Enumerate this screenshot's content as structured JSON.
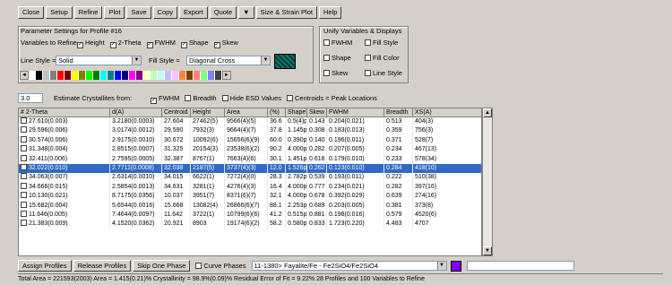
{
  "toolbar": [
    "Close",
    "Setup",
    "Refine",
    "Plot",
    "Save",
    "Copy",
    "Export",
    "Quote",
    "▼",
    "Size & Strain Plot",
    "Help"
  ],
  "params": {
    "group_title": "Parameter Settings for Profile #16",
    "vary_label": "Variables to Refine",
    "vary": [
      {
        "label": "Height",
        "checked": true
      },
      {
        "label": "2-Theta",
        "checked": true
      },
      {
        "label": "FWHM",
        "checked": true
      },
      {
        "label": "Shape",
        "checked": true
      },
      {
        "label": "Skew",
        "checked": true
      }
    ],
    "line_style_label": "Line Style =",
    "line_style": "Solid",
    "fill_style_label": "Fill Style =",
    "fill_style": "Diagonal Cross"
  },
  "display": {
    "group_title": "Unify Variables & Displays",
    "items": [
      [
        "FWHM",
        "Fill Style"
      ],
      [
        "Shape",
        "Fill Color"
      ],
      [
        "Skew",
        "Line Style"
      ]
    ]
  },
  "palette": [
    "#ffffff",
    "#000000",
    "#c0c0c0",
    "#808080",
    "#ff0000",
    "#800000",
    "#ffff00",
    "#808000",
    "#00ff00",
    "#008000",
    "#00ffff",
    "#008080",
    "#0000ff",
    "#000080",
    "#ff00ff",
    "#800080",
    "#ffffc0",
    "#c0ffc0",
    "#c0ffff",
    "#c0c0ff",
    "#ffc0ff",
    "#ff8040",
    "#804000",
    "#ff8080",
    "#80ff80",
    "#8080ff",
    "#404040"
  ],
  "filters": {
    "value": "3.0",
    "text": "Estimate Crystallites from:",
    "items": [
      {
        "label": "FWHM",
        "checked": true
      },
      {
        "label": "Breadth",
        "checked": false
      },
      {
        "label": "Hide ESD Values",
        "checked": false
      },
      {
        "label": "Centroids = Peak Locations",
        "checked": false
      }
    ]
  },
  "table": {
    "headers": [
      "# 2-Theta",
      "d(A)",
      "Centroid",
      "Height",
      "Area",
      "(%)",
      "Shape",
      "Skew",
      "FWHM",
      "Breadth",
      "XS(A)"
    ],
    "rows": [
      [
        "27.610(0.003)",
        "3.2180(0.0003)",
        "27.604",
        "27462(5)",
        "9566(4)(5)",
        "36.6",
        "0.5(4)p",
        "0.143",
        "0.204(0.021)",
        "0.513",
        "404(3)"
      ],
      [
        "29.596(0.006)",
        "3.0174(0.0012)",
        "29.590",
        "7932(3)",
        "9664(4)(7)",
        "37.8",
        "1.145p",
        "0.308",
        "0.183(0.013)",
        "0.359",
        "756(3)"
      ],
      [
        "30.574(0.006)",
        "2.9175(0.0010)",
        "30.672",
        "10092(6)",
        "15656(6)(9)",
        "60.0",
        "0.390p",
        "0.140",
        "0.196(0.011)",
        "0.371",
        "528(7)"
      ],
      [
        "31.348(0.004)",
        "2.8515(0.0007)",
        "31.325",
        "20154(3)",
        "23538(6)(2)",
        "90.2",
        "4.000p",
        "0.282",
        "0.207(0.005)",
        "0.234",
        "467(13)"
      ],
      [
        "32.411(0.006)",
        "2.7595(0.0005)",
        "32.387",
        "8767(1)",
        "7663(4)(6)",
        "30.1",
        "1.451p",
        "0.618",
        "0.179(0.010)",
        "0.233",
        "578(34)"
      ],
      [
        "32.022(0.010)",
        "2.7711(0.0008)",
        "32.038",
        "2187(5)",
        "3737(4)(3)",
        "12.0",
        "1.526p",
        "0.262",
        "0.123(0.010)",
        "0.284",
        "418(10)"
      ],
      [
        "34.063(0.007)",
        "2.6314(0.0010)",
        "34.015",
        "6622(1)",
        "7272(4)(0)",
        "28.3",
        "2.782p",
        "0.539",
        "0.193(0.011)",
        "0.222",
        "510(38)"
      ],
      [
        "34.666(0.015)",
        "2.5854(0.0013)",
        "34.631",
        "3281(1)",
        "4276(4)(3)",
        "16.4",
        "4.000p",
        "0.777",
        "0.234(0.021)",
        "0.282",
        "397(16)"
      ],
      [
        "10.130(0.021)",
        "8.7175(0.0356)",
        "10.037",
        "3951(7)",
        "8371(6)(7)",
        "32.1",
        "4.000p",
        "0.678",
        "0.392(0.029)",
        "0.639",
        "274(16)"
      ],
      [
        "15.682(0.004)",
        "5.6544(0.0016)",
        "15.668",
        "13082(4)",
        "26866(6)(7)",
        "88.1",
        "2.253p",
        "0.689",
        "0.203(0.005)",
        "0.381",
        "373(8)"
      ],
      [
        "11.646(0.005)",
        "7.4644(0.0097)",
        "11.642",
        "3722(1)",
        "10799(6)(6)",
        "41.2",
        "0.515p",
        "0.881",
        "0.198(0.016)",
        "0.579",
        "4520(6)"
      ],
      [
        "21.383(0.009)",
        "4.1520(0.0362)",
        "20.921",
        "8903",
        "19174(6)(2)",
        "58.2",
        "0.580p",
        "0.833",
        "1.723(0.220)",
        "4.483",
        "4707"
      ]
    ],
    "highlight_index": 5
  },
  "bottom": {
    "buttons": [
      "Assign Profiles",
      "Release Profiles",
      "Skip One Phase"
    ],
    "phase_label": "Curve Phases",
    "phase_value": "11-1380> Fayalite/Fe - Fe2SiO4/Fe2SiO4",
    "phase_color": "#8000ff"
  },
  "status": "Total Area = 221593(2003)   Area = 1.415(0.21)%   Crystallinity = 98.9%(0.09)%   Residual Error of Fit = 9.22%   28 Profiles and 100 Variables to Refine"
}
